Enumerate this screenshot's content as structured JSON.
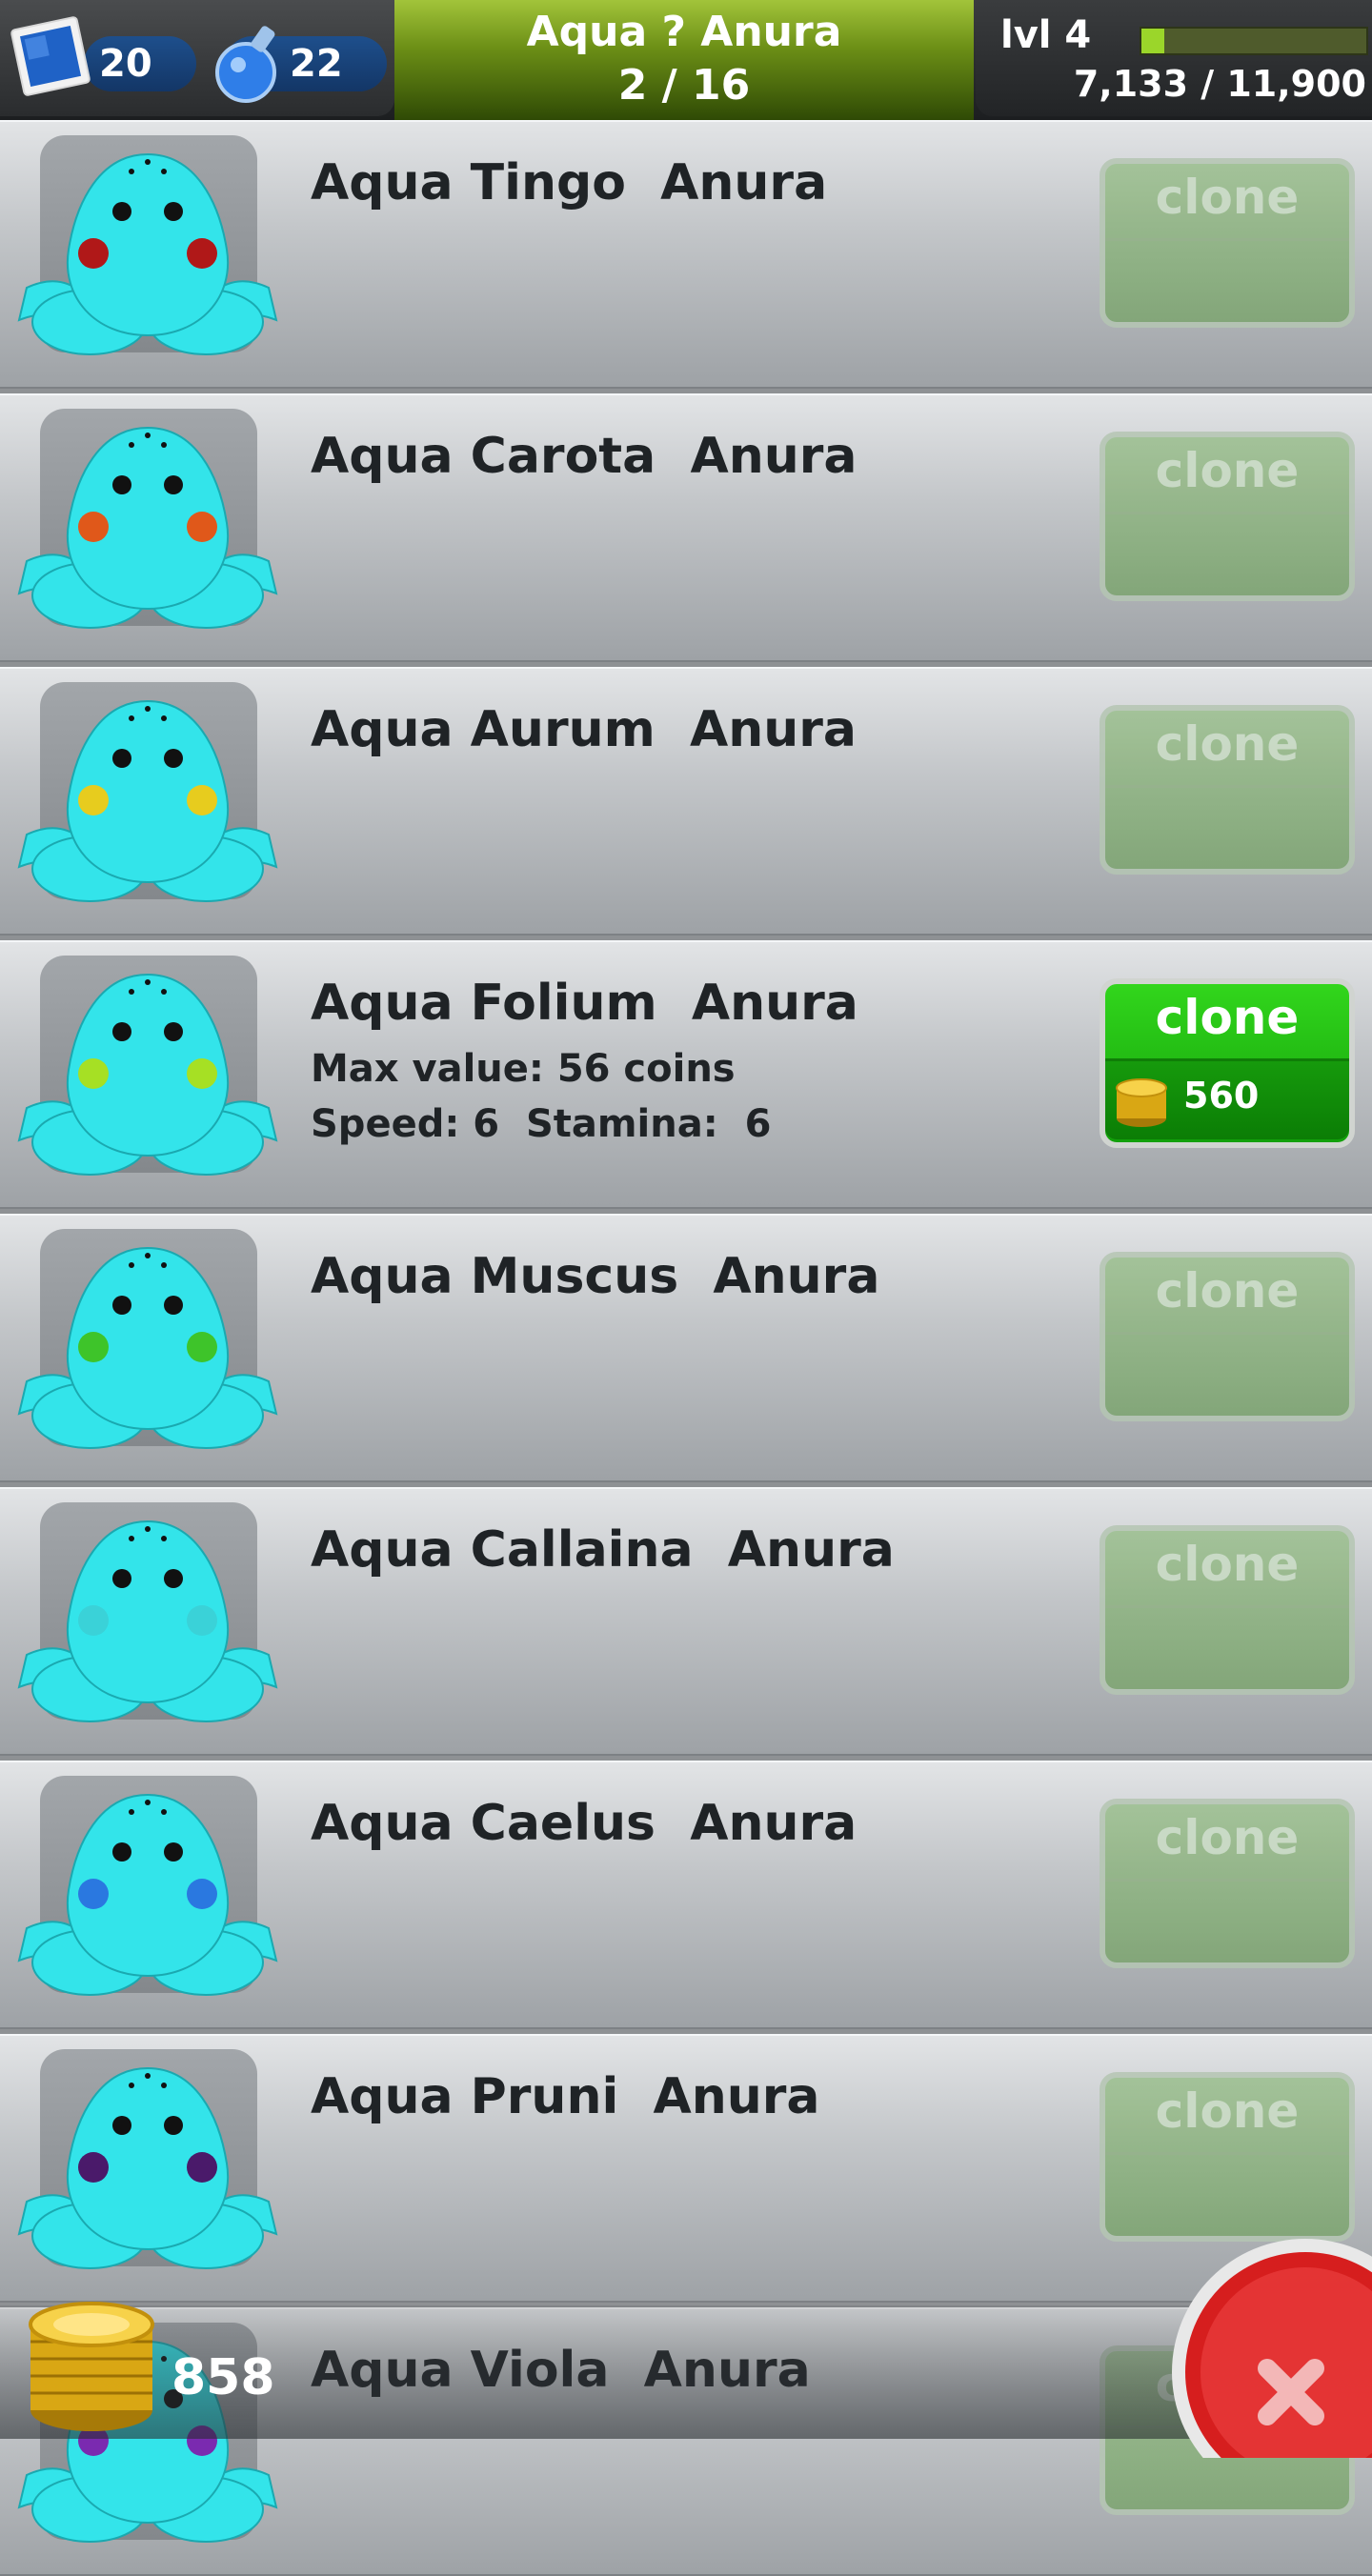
{
  "hud": {
    "stamps": "20",
    "potions": "22",
    "title": "Aqua ? Anura",
    "progress": "2 / 16",
    "level": "lvl 4",
    "xp": "7,133 / 11,900",
    "xp_fraction": 0.1
  },
  "rows": [
    {
      "name": "Aqua Tingo  Anura",
      "spot_color": "#b01818",
      "clone_label": "clone",
      "enabled": false
    },
    {
      "name": "Aqua Carota  Anura",
      "spot_color": "#e0581a",
      "clone_label": "clone",
      "enabled": false
    },
    {
      "name": "Aqua Aurum  Anura",
      "spot_color": "#e7cc1e",
      "clone_label": "clone",
      "enabled": false
    },
    {
      "name": "Aqua Folium  Anura",
      "spot_color": "#a6e024",
      "clone_label": "clone",
      "enabled": true,
      "detail1": "Max value: 56 coins",
      "detail2": "Speed: 6  Stamina:  6",
      "price": "560"
    },
    {
      "name": "Aqua Muscus  Anura",
      "spot_color": "#3ec42a",
      "clone_label": "clone",
      "enabled": false
    },
    {
      "name": "Aqua Callaina  Anura",
      "spot_color": "#3ad2d8",
      "clone_label": "clone",
      "enabled": false
    },
    {
      "name": "Aqua Caelus  Anura",
      "spot_color": "#2a78e0",
      "clone_label": "clone",
      "enabled": false
    },
    {
      "name": "Aqua Pruni  Anura",
      "spot_color": "#4a1a6a",
      "clone_label": "clone",
      "enabled": false
    },
    {
      "name": "Aqua Viola  Anura",
      "spot_color": "#7a2ab0",
      "clone_label": "clone",
      "enabled": false
    }
  ],
  "footer": {
    "coins": "858"
  },
  "icons": {
    "stamp": "stamp-icon",
    "potion": "potion-icon",
    "coin": "coin-stack-icon",
    "close": "close-icon"
  },
  "colors": {
    "frog_body": "#33e4ea",
    "clone_active": "#22c412",
    "close_red": "#d61e1e"
  }
}
